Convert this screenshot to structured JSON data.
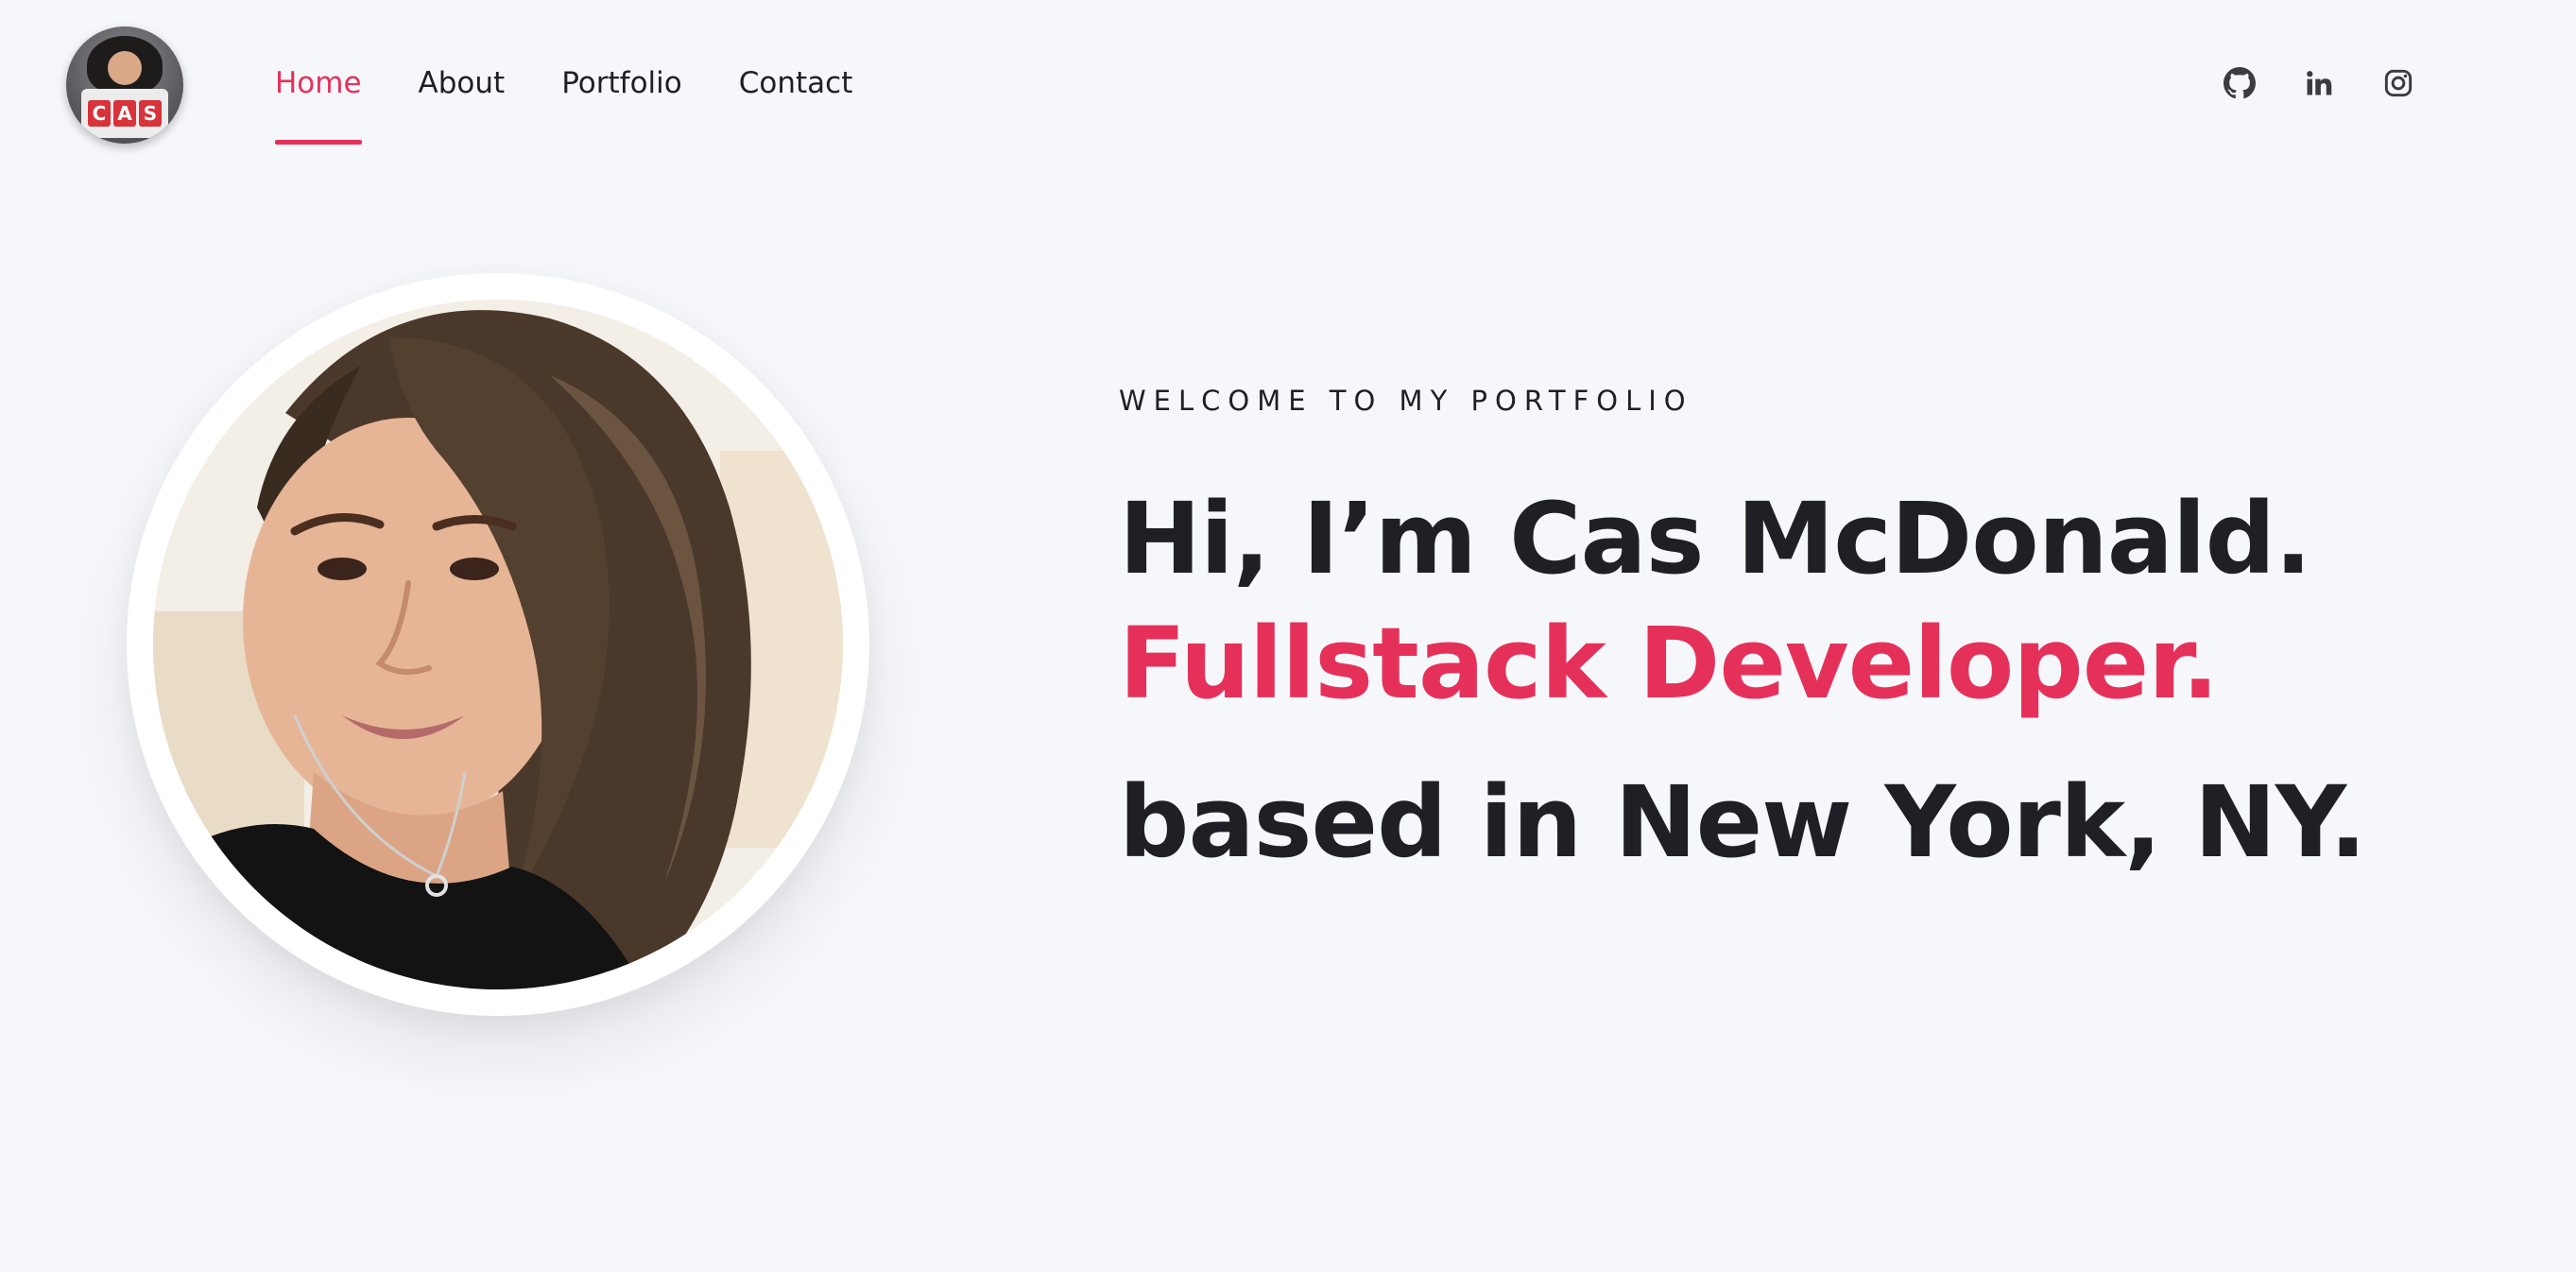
{
  "header": {
    "logo_letters": [
      "C",
      "A",
      "S"
    ],
    "nav": [
      {
        "label": "Home",
        "active": true
      },
      {
        "label": "About",
        "active": false
      },
      {
        "label": "Portfolio",
        "active": false
      },
      {
        "label": "Contact",
        "active": false
      }
    ],
    "socials": [
      {
        "icon": "github-icon"
      },
      {
        "icon": "linkedin-icon"
      },
      {
        "icon": "instagram-icon"
      }
    ]
  },
  "hero": {
    "eyebrow": "WELCOME TO MY PORTFOLIO",
    "headline": "Hi, I’m Cas McDonald.",
    "role": "Fullstack Developer.",
    "location": "based in New York, NY."
  },
  "colors": {
    "accent": "#e5315a",
    "text": "#1f1f25",
    "background": "#f6f7fb"
  }
}
